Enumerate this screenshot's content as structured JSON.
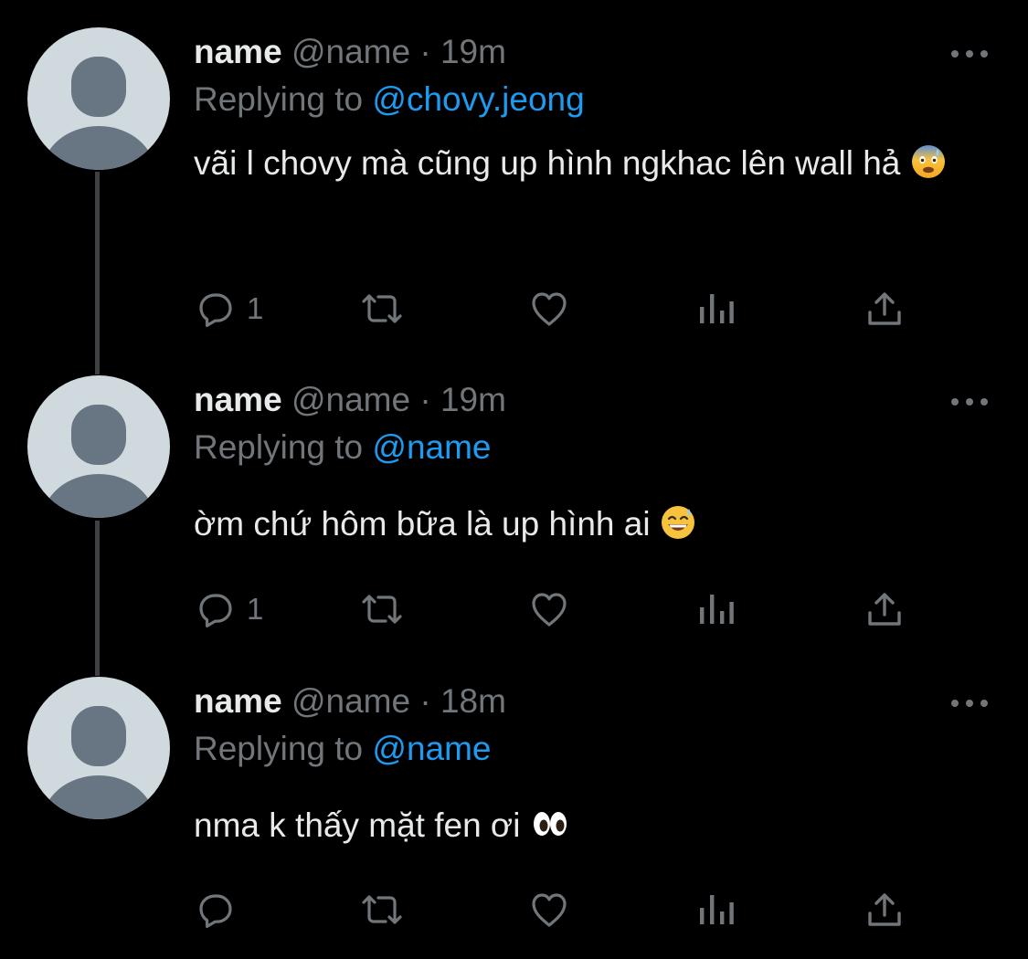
{
  "tweets": [
    {
      "display_name": "name",
      "handle": "@name",
      "separator": "·",
      "time": "19m",
      "replying_prefix": "Replying to",
      "replying_to": "@chovy.jeong",
      "text": "vãi l chovy mà cũng up hình ngkhac lên wall hả",
      "emoji": "anxious-face-with-sweat",
      "reply_count": "1",
      "icons": [
        "reply-icon",
        "retweet-icon",
        "like-icon",
        "analytics-icon",
        "share-icon"
      ]
    },
    {
      "display_name": "name",
      "handle": "@name",
      "separator": "·",
      "time": "19m",
      "replying_prefix": "Replying to",
      "replying_to": "@name",
      "text": "ờm chứ hôm bữa là up hình ai",
      "emoji": "grinning-face-with-sweat",
      "reply_count": "1",
      "icons": [
        "reply-icon",
        "retweet-icon",
        "like-icon",
        "analytics-icon",
        "share-icon"
      ]
    },
    {
      "display_name": "name",
      "handle": "@name",
      "separator": "·",
      "time": "18m",
      "replying_prefix": "Replying to",
      "replying_to": "@name",
      "text": "nma k thấy mặt fen ơi",
      "emoji": "eyes",
      "reply_count": "",
      "icons": [
        "reply-icon",
        "retweet-icon",
        "like-icon",
        "analytics-icon",
        "share-icon"
      ]
    }
  ],
  "colors": {
    "background": "#000000",
    "text": "#e7e9ea",
    "muted": "#71767b",
    "link": "#1d9bf0",
    "thread_line": "#3e4144",
    "avatar_bg": "#cfd9de",
    "avatar_figure": "#687684"
  }
}
